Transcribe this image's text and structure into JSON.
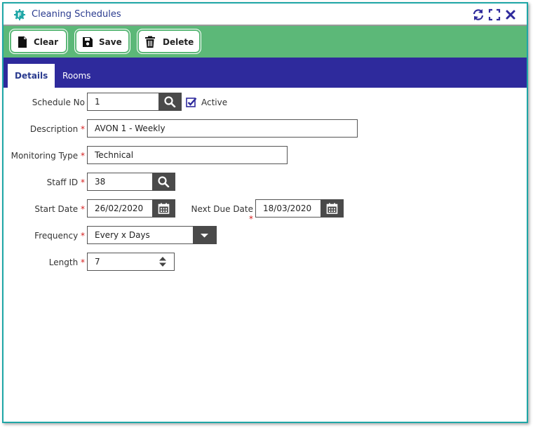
{
  "window": {
    "title": "Cleaning Schedules",
    "controls": [
      "refresh-icon",
      "maximize-icon",
      "close-icon"
    ]
  },
  "toolbar": {
    "clear_label": "Clear",
    "save_label": "Save",
    "delete_label": "Delete"
  },
  "tabs": [
    {
      "label": "Details",
      "active": true
    },
    {
      "label": "Rooms",
      "active": false
    }
  ],
  "form": {
    "schedule_no": {
      "label": "Schedule No",
      "value": "1"
    },
    "active": {
      "label": "Active",
      "checked": true
    },
    "description": {
      "label": "Description",
      "required": "*",
      "value": "AVON 1 - Weekly"
    },
    "monitoring_type": {
      "label": "Monitoring Type",
      "required": "*",
      "value": "Technical"
    },
    "staff_id": {
      "label": "Staff ID",
      "required": "*",
      "value": "38"
    },
    "start_date": {
      "label": "Start Date",
      "required": "*",
      "value": "26/02/2020"
    },
    "next_due_date": {
      "label": "Next Due Date",
      "required": "*",
      "value": "18/03/2020"
    },
    "frequency": {
      "label": "Frequency",
      "required": "*",
      "value": "Every x Days"
    },
    "length": {
      "label": "Length",
      "required": "*",
      "value": "7"
    }
  },
  "colors": {
    "toolbar": "#5cb878",
    "tabbar": "#2e2a9c",
    "window_border": "#1ea6a6",
    "title_text": "#2a3b8f",
    "required": "#d62020"
  }
}
